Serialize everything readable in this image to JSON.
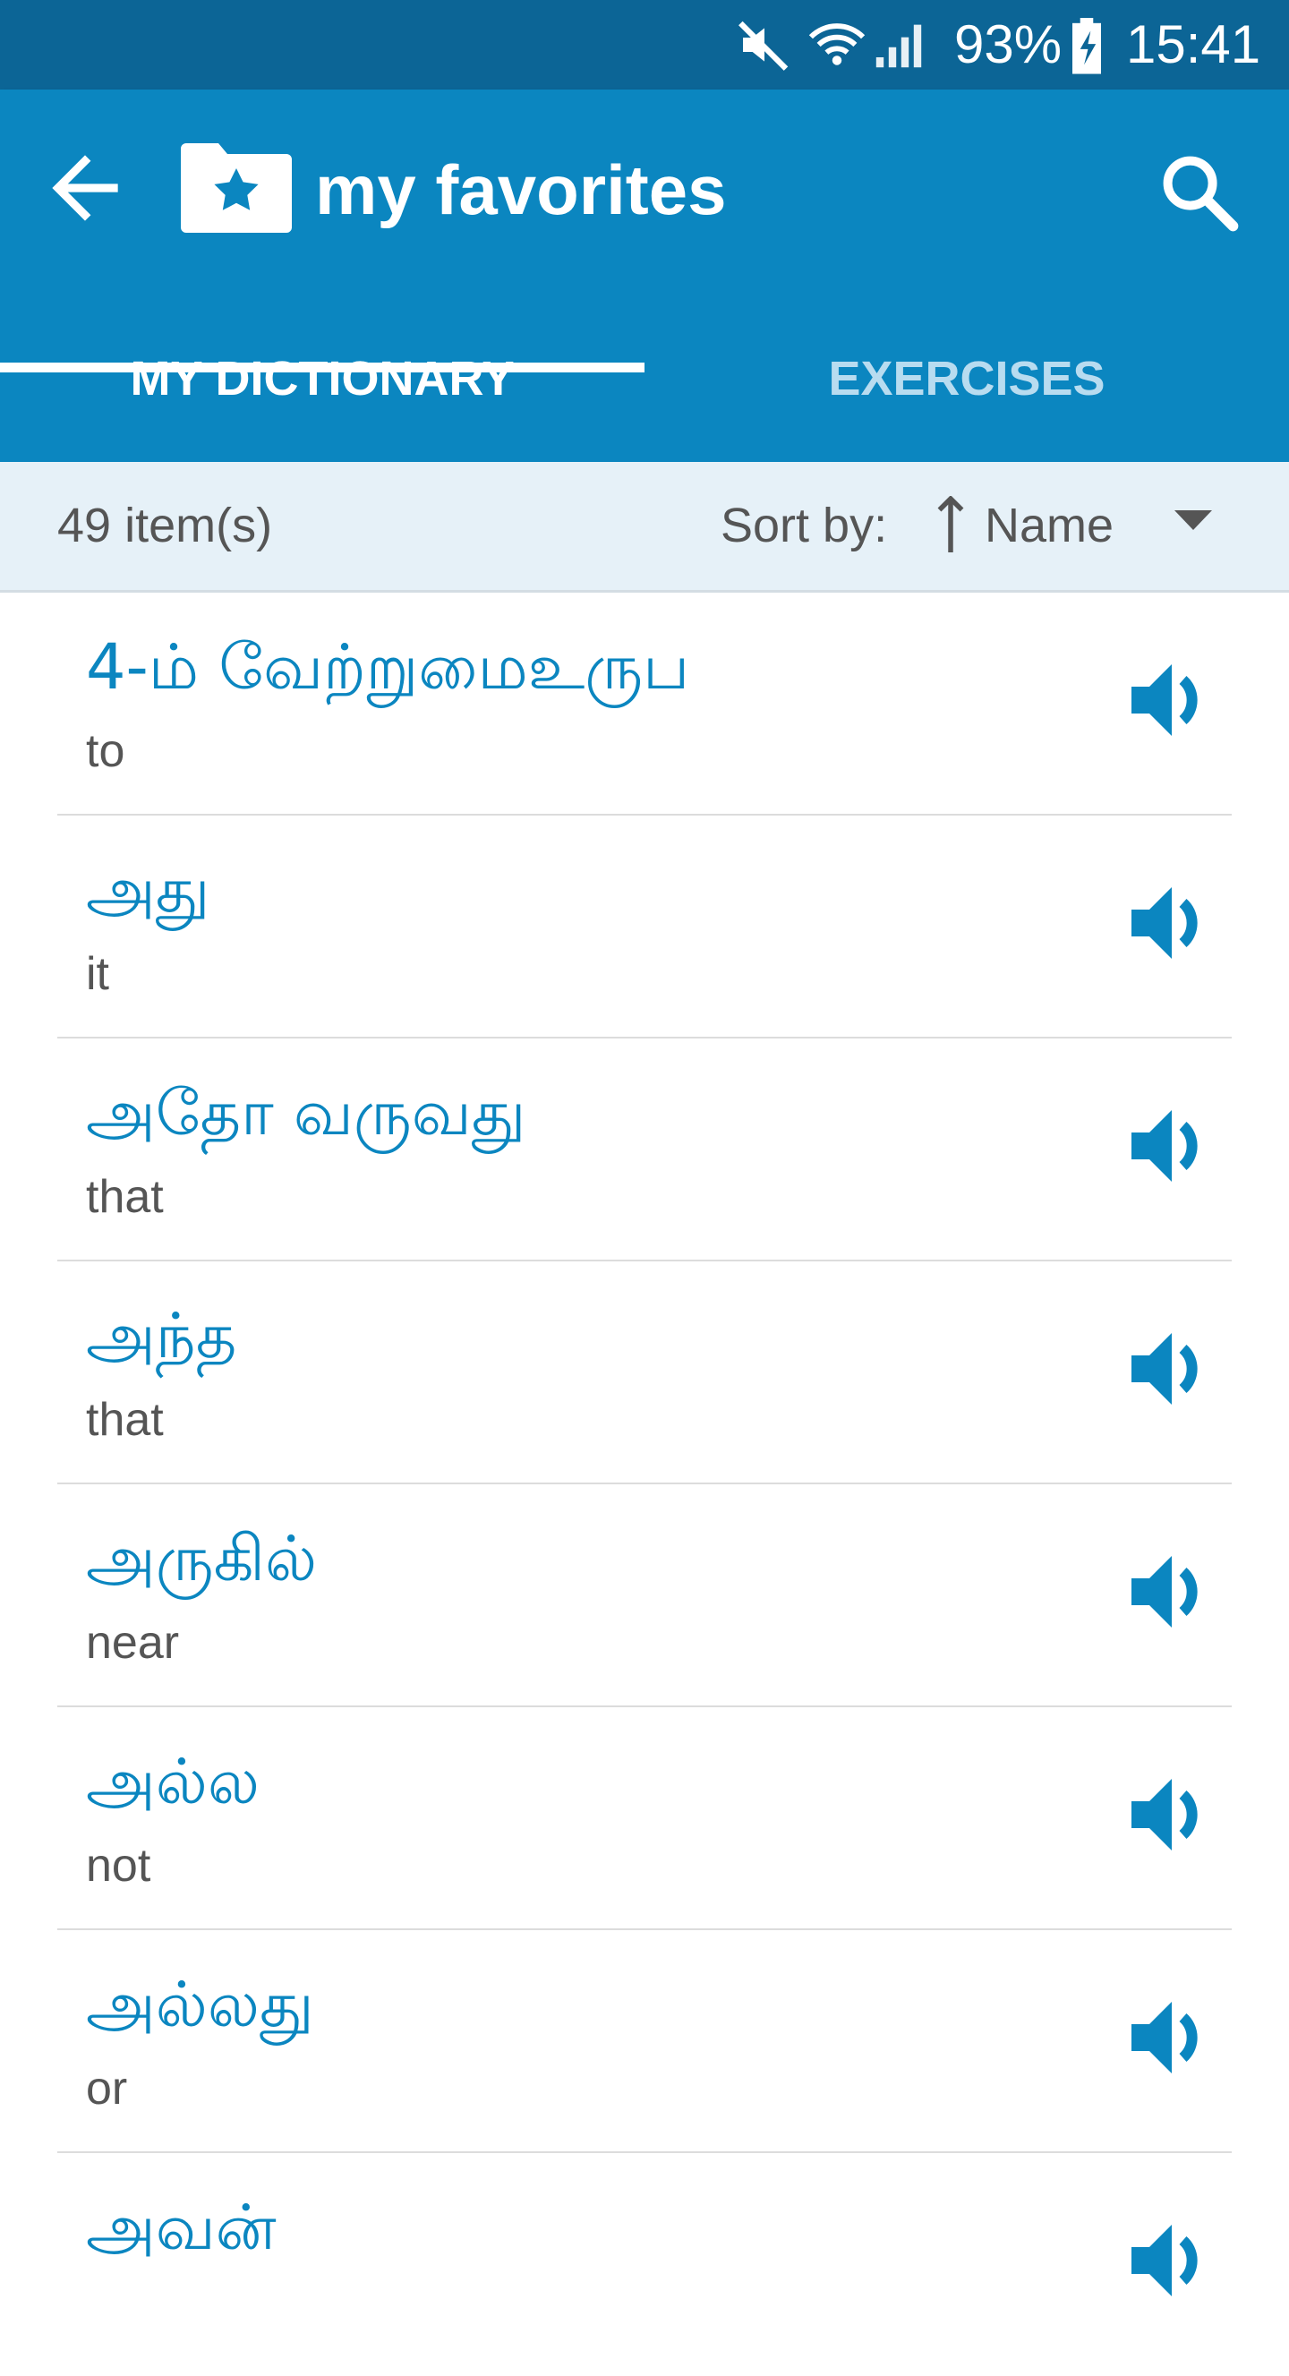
{
  "status_bar": {
    "battery": "93%",
    "time": "15:41"
  },
  "header": {
    "title": "my favorites",
    "tabs": [
      {
        "label": "MY DICTIONARY"
      },
      {
        "label": "EXERCISES"
      }
    ]
  },
  "toolbar": {
    "item_count": "49 item(s)",
    "sort_label": "Sort by:",
    "sort_value": "Name"
  },
  "words": [
    {
      "term": "4-ம் வேற்றுமைஉருப",
      "translation": "to"
    },
    {
      "term": "அது",
      "translation": "it"
    },
    {
      "term": "அதோ வருவது",
      "translation": "that"
    },
    {
      "term": "அந்த",
      "translation": "that"
    },
    {
      "term": "அருகில்",
      "translation": "near"
    },
    {
      "term": "அல்ல",
      "translation": "not"
    },
    {
      "term": "அல்லது",
      "translation": "or"
    },
    {
      "term": "அவன்",
      "translation": ""
    }
  ],
  "colors": {
    "status_bar": "#0c6596",
    "app_bar": "#0b86c0",
    "accent": "#0b86c0",
    "toolbar_bg": "#e6f1f8"
  }
}
